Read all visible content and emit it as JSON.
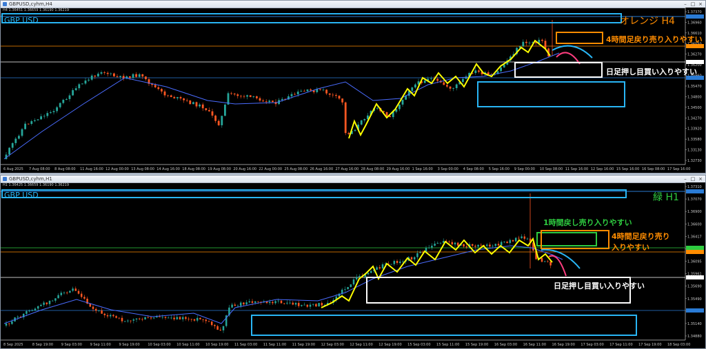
{
  "panels": [
    {
      "window_title": "GBPUSD,cyhm,H4",
      "symbol_label": "GBP USD",
      "tf_label": "オレンジ H4",
      "tf_color": "#ff8c00",
      "info_line": "H4 1.36451 1.36659 1.36190 1.36219",
      "annotations": [
        "4時間足戻り売り入りやすい",
        "日足押し目買い入りやすい"
      ],
      "price_labels": [
        "1.37370",
        "1.36960",
        "1.36610",
        "1.36550",
        "1.36270",
        "1.36200",
        "1.35960",
        "1.35470",
        "1.34800",
        "1.34500",
        "1.34270",
        "1.33920",
        "1.33580",
        "1.33130",
        "1.32730"
      ],
      "time_labels": [
        "6 Aug 2025",
        "7 Aug 08:00",
        "8 Aug 08:00",
        "11 Aug 16:00",
        "12 Aug 00:00",
        "13 Aug 08:00",
        "14 Aug 16:00",
        "18 Aug 08:00",
        "19 Aug 08:00",
        "20 Aug 16:00",
        "22 Aug 00:00",
        "25 Aug 08:00",
        "26 Aug 16:00",
        "27 Aug 16:00",
        "28 Aug 08:00",
        "29 Aug 16:00",
        "1 Sep 16:00",
        "3 Sep 00:00",
        "4 Sep 08:00",
        "5 Sep 16:00",
        "9 Sep 00:00",
        "10 Sep 08:00",
        "11 Sep 16:00",
        "12 Sep 16:00",
        "15 Sep 16:00",
        "16 Sep 08:00",
        "17 Sep 16:00"
      ]
    },
    {
      "window_title": "GBPUSD,cyhm,H1",
      "symbol_label": "GBP USD",
      "tf_label": "緑 H1",
      "tf_color": "#2ecc40",
      "info_line": "H1 1.36425 1.36659 1.36190 1.36219",
      "annotations": [
        "1時間戻し売り入りやすい",
        "4時間足戻り売り",
        "入りやすい",
        "日足押し目買い入りやすい"
      ],
      "price_labels": [
        "1.37310",
        "1.37070",
        "1.36900",
        "1.36600",
        "1.36417",
        "1.36280",
        "1.36095",
        "1.35961",
        "1.35690",
        "1.35490",
        "1.35290",
        "1.35140",
        "1.34880"
      ],
      "time_labels": [
        "8 Sep 2025",
        "8 Sep 19:00",
        "9 Sep 03:00",
        "9 Sep 11:00",
        "9 Sep 19:00",
        "10 Sep 03:00",
        "10 Sep 11:00",
        "10 Sep 19:00",
        "11 Sep 03:00",
        "11 Sep 11:00",
        "11 Sep 19:00",
        "12 Sep 03:00",
        "12 Sep 11:00",
        "12 Sep 19:00",
        "15 Sep 03:00",
        "15 Sep 11:00",
        "15 Sep 19:00",
        "16 Sep 03:00",
        "16 Sep 11:00",
        "16 Sep 19:00",
        "17 Sep 03:00",
        "17 Sep 11:00",
        "17 Sep 19:00",
        "18 Sep 03:00"
      ]
    }
  ],
  "colors": {
    "bull": "#26a69a",
    "bear": "#ff5722",
    "ma": "#4a6cff",
    "zigzag": "#ffff00",
    "box_cyan": "#29b6f6",
    "box_orange": "#ff8c00",
    "box_white": "#ffffff",
    "box_green": "#2ecc40"
  }
}
